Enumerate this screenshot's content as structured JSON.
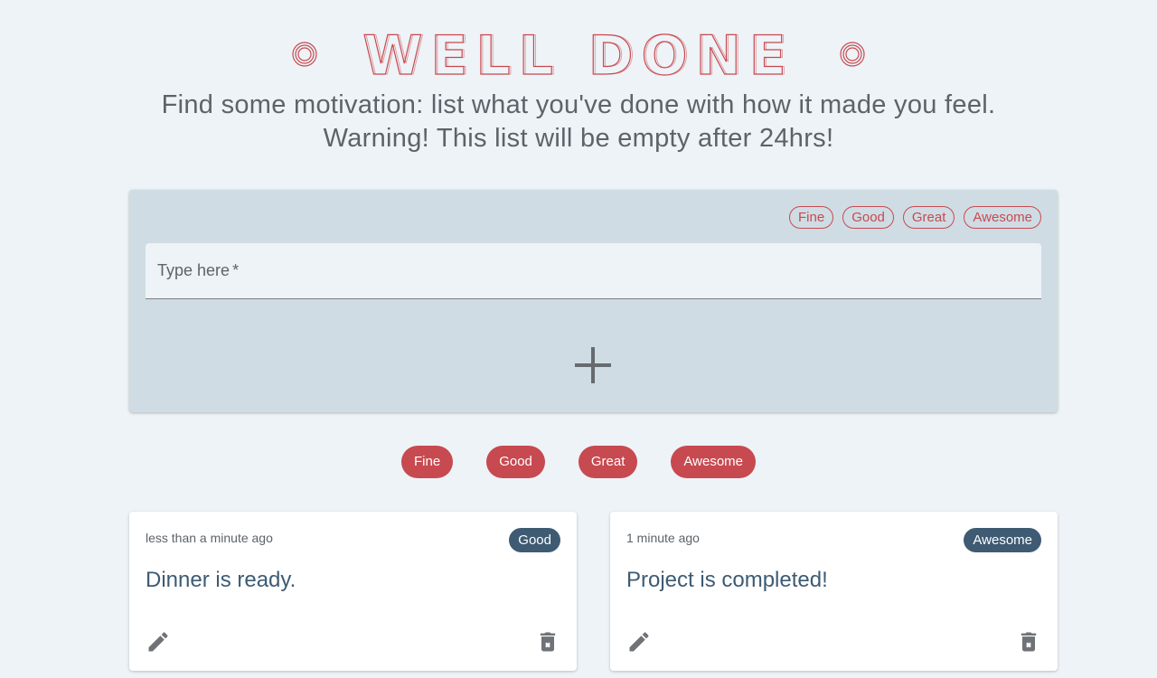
{
  "header": {
    "title": "WELL DONE",
    "subtitle_line1": "Find some motivation: list what you've done with how it made you feel.",
    "subtitle_line2": "Warning! This list will be empty after 24hrs!"
  },
  "form": {
    "choices": [
      "Fine",
      "Good",
      "Great",
      "Awesome"
    ],
    "input_label": "Type here",
    "required_marker": "*",
    "add_icon": "plus-icon"
  },
  "filters": [
    "Fine",
    "Good",
    "Great",
    "Awesome"
  ],
  "entries": [
    {
      "time": "less than a minute ago",
      "badge": "Good",
      "text": "Dinner is ready."
    },
    {
      "time": "1 minute ago",
      "badge": "Awesome",
      "text": "Project is completed!"
    }
  ],
  "colors": {
    "background": "#eef3f7",
    "accent_red": "#c74a50",
    "badge_blue": "#3e5b73",
    "form_bg": "#cfdce4",
    "icon_gray": "#6f7378"
  },
  "icons": {
    "edit": "pencil-icon",
    "delete": "trash-icon",
    "title_ornament": "circle-ornament-icon"
  }
}
